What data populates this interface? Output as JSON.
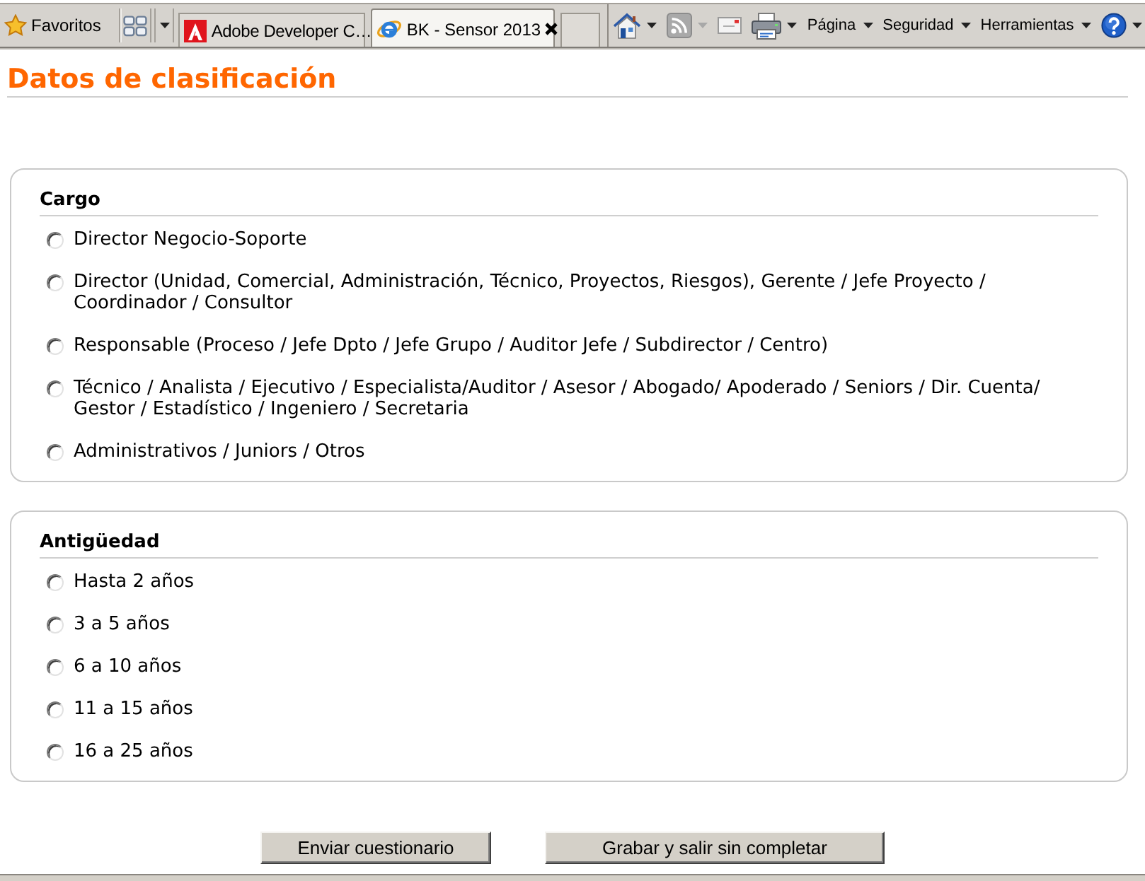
{
  "toolbar": {
    "favorites": "Favoritos",
    "tabs": [
      {
        "label": "Adobe Developer C…",
        "kind": "document",
        "selected": false
      },
      {
        "label": "BK - Sensor 2013",
        "kind": "web",
        "selected": true
      }
    ],
    "commands": [
      {
        "kind": "home",
        "dropdown": true,
        "disabled": false
      },
      {
        "kind": "feeds",
        "dropdown": true,
        "disabled": true
      },
      {
        "kind": "mail",
        "dropdown": false,
        "disabled": false
      },
      {
        "kind": "print",
        "dropdown": true,
        "disabled": false
      },
      {
        "kind": "menu",
        "label": "Página",
        "dropdown": true,
        "disabled": false
      },
      {
        "kind": "menu",
        "label": "Seguridad",
        "dropdown": true,
        "disabled": false
      },
      {
        "kind": "menu",
        "label": "Herramientas",
        "dropdown": true,
        "disabled": false
      },
      {
        "kind": "help",
        "dropdown": true,
        "disabled": false
      }
    ]
  },
  "page": {
    "title": "Datos de clasificación",
    "sections": [
      {
        "legend": "Cargo",
        "options": [
          {
            "label": "Director Negocio-Soporte",
            "selected": false
          },
          {
            "label": "Director (Unidad, Comercial, Administración, Técnico, Proyectos, Riesgos), Gerente / Jefe Proyecto / Coordinador / Consultor",
            "selected": false
          },
          {
            "label": "Responsable (Proceso / Jefe Dpto / Jefe Grupo / Auditor Jefe / Subdirector / Centro)",
            "selected": false
          },
          {
            "label": "Técnico / Analista / Ejecutivo / Especialista/Auditor / Asesor / Abogado/ Apoderado / Seniors / Dir. Cuenta/ Gestor / Estadístico / Ingeniero / Secretaria",
            "selected": false
          },
          {
            "label": "Administrativos / Juniors / Otros",
            "selected": false
          }
        ]
      },
      {
        "legend": "Antigüedad",
        "options": [
          {
            "label": "Hasta 2 años",
            "selected": false
          },
          {
            "label": "3 a 5 años",
            "selected": false
          },
          {
            "label": "6 a 10 años",
            "selected": false
          },
          {
            "label": "11 a 15 años",
            "selected": false
          },
          {
            "label": "16 a 25 años",
            "selected": false
          }
        ]
      }
    ],
    "buttons": [
      "Enviar cuestionario",
      "Grabar y salir sin completar"
    ]
  }
}
